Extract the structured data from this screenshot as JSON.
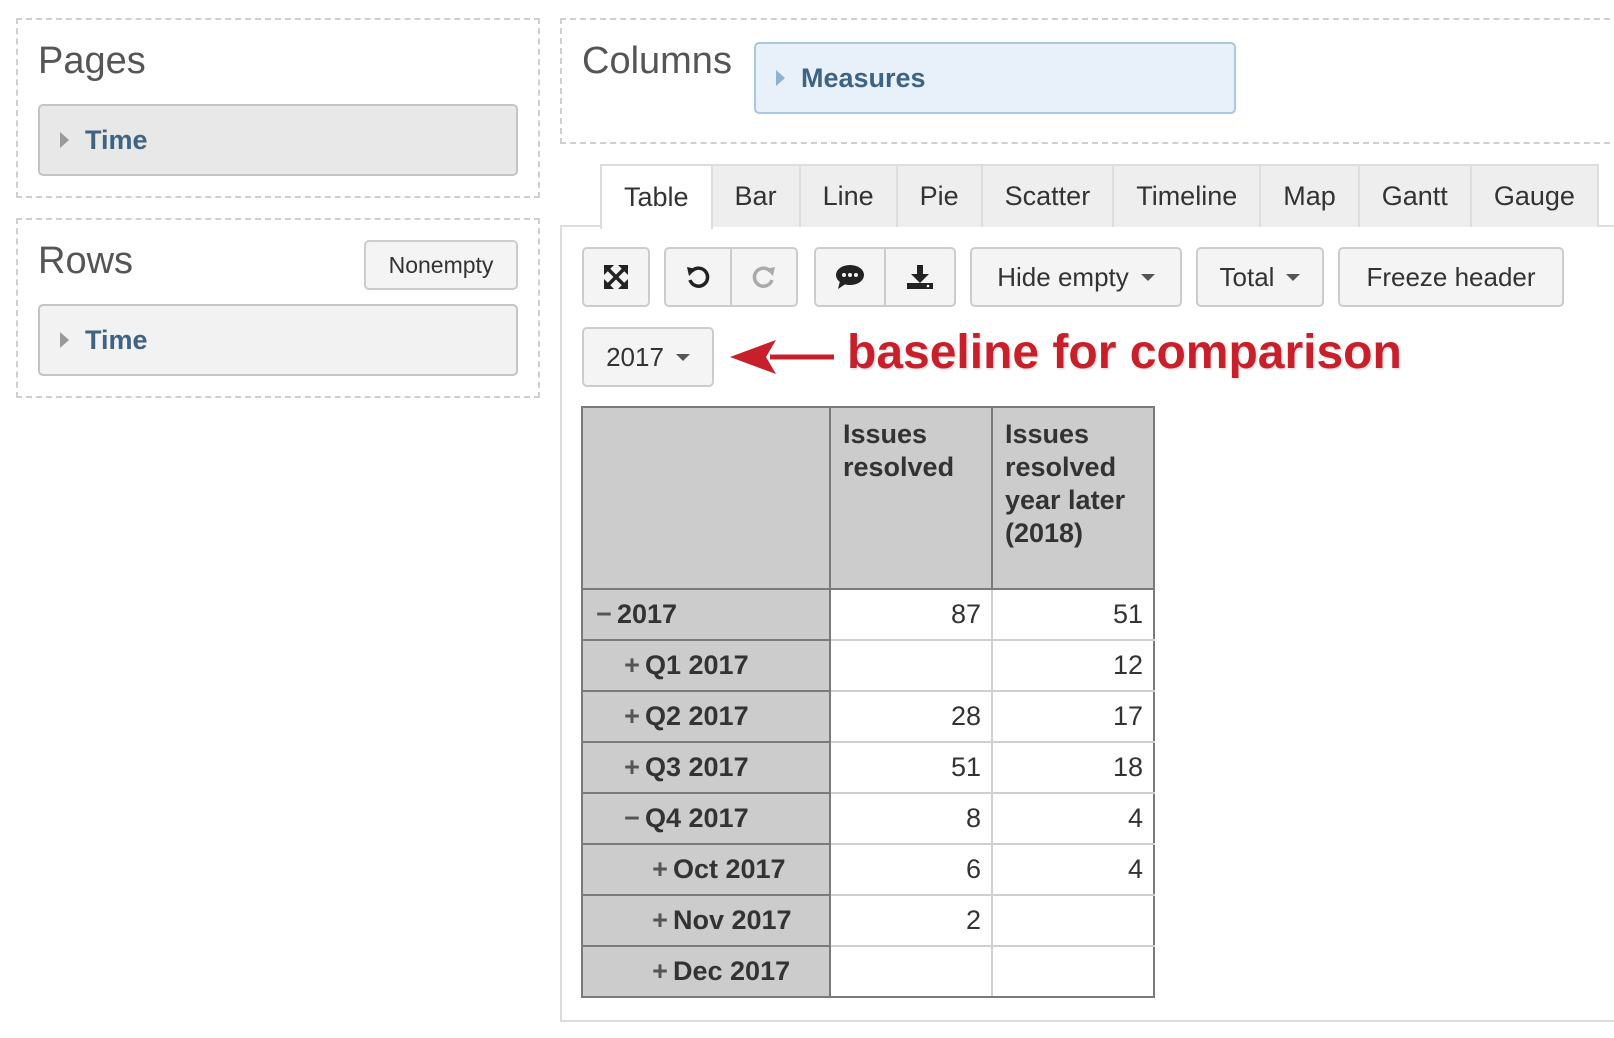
{
  "pages": {
    "title": "Pages",
    "dimension": "Time"
  },
  "rows": {
    "title": "Rows",
    "nonempty_label": "Nonempty",
    "dimension": "Time"
  },
  "columns": {
    "title": "Columns",
    "dimension": "Measures"
  },
  "tabs": [
    "Table",
    "Bar",
    "Line",
    "Pie",
    "Scatter",
    "Timeline",
    "Map",
    "Gantt",
    "Gauge"
  ],
  "active_tab": "Table",
  "toolbar": {
    "fullscreen_icon": "expand-arrows-icon",
    "undo_icon": "undo-icon",
    "redo_icon": "redo-icon",
    "comment_icon": "comment-icon",
    "export_icon": "download-icon",
    "hide_empty_label": "Hide empty",
    "total_label": "Total",
    "freeze_header_label": "Freeze header"
  },
  "page_selector": {
    "value": "2017"
  },
  "annotation": {
    "text": "baseline for comparison",
    "color": "#c8202b"
  },
  "table": {
    "headers": [
      "Issues resolved",
      "Issues resolved year later (2018)"
    ],
    "rows": [
      {
        "label": "2017",
        "sign": "−",
        "level": 0,
        "values": [
          "87",
          "51"
        ]
      },
      {
        "label": "Q1 2017",
        "sign": "+",
        "level": 1,
        "values": [
          "",
          "12"
        ]
      },
      {
        "label": "Q2 2017",
        "sign": "+",
        "level": 1,
        "values": [
          "28",
          "17"
        ]
      },
      {
        "label": "Q3 2017",
        "sign": "+",
        "level": 1,
        "values": [
          "51",
          "18"
        ]
      },
      {
        "label": "Q4 2017",
        "sign": "−",
        "level": 1,
        "values": [
          "8",
          "4"
        ]
      },
      {
        "label": "Oct 2017",
        "sign": "+",
        "level": 2,
        "values": [
          "6",
          "4"
        ]
      },
      {
        "label": "Nov 2017",
        "sign": "+",
        "level": 2,
        "values": [
          "2",
          ""
        ]
      },
      {
        "label": "Dec 2017",
        "sign": "+",
        "level": 2,
        "values": [
          "",
          ""
        ]
      }
    ]
  }
}
